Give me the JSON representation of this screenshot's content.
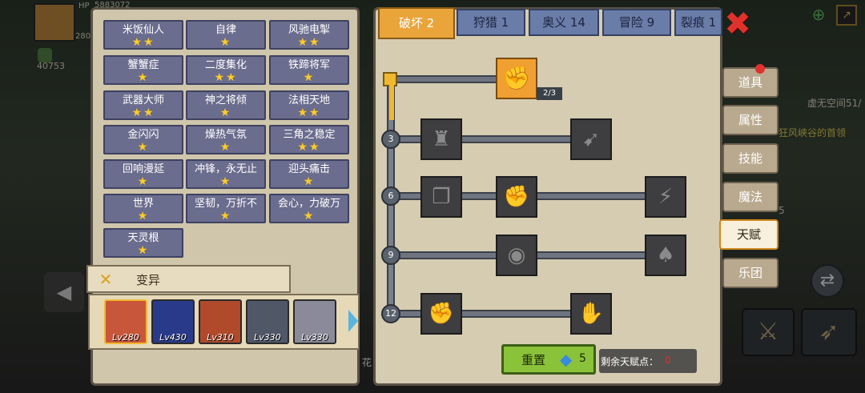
{
  "hud": {
    "hp_label": "HP",
    "hp_value": "5883072",
    "level_badge": "280",
    "power": "40753",
    "void_space": "虚无空间51/",
    "canyon_boss": "狂风峡谷的首领",
    "side_number": "5",
    "bottom_char": "花"
  },
  "talents": [
    {
      "name": "米饭仙人",
      "stars": 2
    },
    {
      "name": "自律",
      "stars": 1
    },
    {
      "name": "风驰电掣",
      "stars": 2
    },
    {
      "name": "蟹蟹症",
      "stars": 1
    },
    {
      "name": "二度集化",
      "stars": 2
    },
    {
      "name": "铁蹄将军",
      "stars": 1
    },
    {
      "name": "武器大师",
      "stars": 2
    },
    {
      "name": "神之将倾",
      "stars": 1
    },
    {
      "name": "法相天地",
      "stars": 2
    },
    {
      "name": "金闪闪",
      "stars": 1
    },
    {
      "name": "燥热气氛",
      "stars": 1
    },
    {
      "name": "三角之稳定",
      "stars": 2
    },
    {
      "name": "回响漫延",
      "stars": 1
    },
    {
      "name": "冲锋，永无止",
      "stars": 1
    },
    {
      "name": "迎头痛击",
      "stars": 1
    },
    {
      "name": "世界",
      "stars": 1
    },
    {
      "name": "坚韧，万折不",
      "stars": 1
    },
    {
      "name": "会心，力破万",
      "stars": 1
    },
    {
      "name": "天灵根",
      "stars": 1
    }
  ],
  "mutation": {
    "label": "变异"
  },
  "heroes": [
    {
      "level": "Lv280",
      "color": "#c8563a"
    },
    {
      "level": "Lv430",
      "color": "#2a3a8a"
    },
    {
      "level": "Lv310",
      "color": "#b04a2a"
    },
    {
      "level": "Lv330",
      "color": "#505868"
    },
    {
      "level": "Lv330",
      "color": "#8a8a9a"
    }
  ],
  "tabs": [
    {
      "label": "破坏 2",
      "active": true
    },
    {
      "label": "狩猎 1",
      "active": false
    },
    {
      "label": "奥义 14",
      "active": false
    },
    {
      "label": "冒险 9",
      "active": false
    },
    {
      "label": "裂痕 1",
      "active": false
    }
  ],
  "tree": {
    "top_node_progress": "2/3",
    "levels": [
      "3",
      "6",
      "9",
      "12"
    ]
  },
  "reset": {
    "label": "重置",
    "cost": "5",
    "remaining_label": "剩余天赋点：",
    "remaining_value": "0"
  },
  "side_menu": [
    {
      "label": "道具",
      "active": false
    },
    {
      "label": "属性",
      "active": false
    },
    {
      "label": "技能",
      "active": false
    },
    {
      "label": "魔法",
      "active": false
    },
    {
      "label": "天赋",
      "active": true
    },
    {
      "label": "乐团",
      "active": false
    }
  ],
  "colors": {
    "star": "#ffcc22",
    "tile": "#6b6d8e",
    "active_tab": "#e9a43a",
    "reset": "#8ac23a",
    "remaining_value": "#e0322c"
  }
}
